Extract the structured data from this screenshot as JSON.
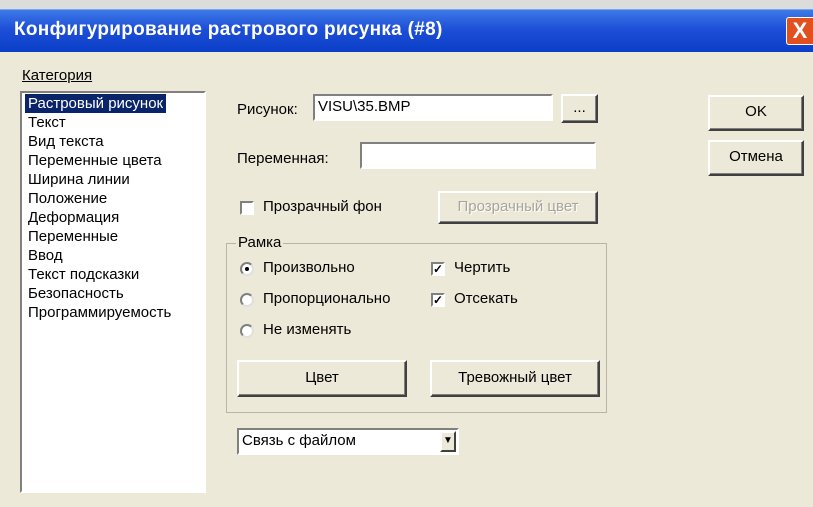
{
  "window": {
    "title": "Конфигурирование растрового рисунка (#8)",
    "close_glyph": "X"
  },
  "category": {
    "label": "Категория",
    "items": [
      {
        "label": "Растровый рисунок",
        "selected": true
      },
      {
        "label": "Текст"
      },
      {
        "label": "Вид текста"
      },
      {
        "label": "Переменные цвета"
      },
      {
        "label": "Ширина линии"
      },
      {
        "label": "Положение"
      },
      {
        "label": "Деформация"
      },
      {
        "label": "Переменные"
      },
      {
        "label": "Ввод"
      },
      {
        "label": "Текст подсказки"
      },
      {
        "label": "Безопасность"
      },
      {
        "label": "Программируемость"
      }
    ]
  },
  "picture": {
    "label": "Рисунок:",
    "value": "VISU\\35.BMP",
    "browse_label": "..."
  },
  "variable": {
    "label": "Переменная:",
    "value": ""
  },
  "transparent": {
    "label": "Прозрачный фон",
    "checked": false,
    "color_button": "Прозрачный цвет"
  },
  "frame": {
    "label": "Рамка",
    "radios": [
      {
        "label": "Произвольно",
        "selected": true
      },
      {
        "label": "Пропорционально",
        "selected": false
      },
      {
        "label": "Не изменять",
        "selected": false
      }
    ],
    "checks": [
      {
        "label": "Чертить",
        "checked": true
      },
      {
        "label": "Отсекать",
        "checked": true
      }
    ],
    "color_button": "Цвет",
    "alarm_color_button": "Тревожный цвет"
  },
  "file_link": {
    "value": "Связь с файлом",
    "arrow_glyph": "▼"
  },
  "buttons": {
    "ok": "OK",
    "cancel": "Отмена"
  },
  "colors": {
    "titlebar": "#1d4fd8",
    "selection": "#0a246a",
    "dialog_bg": "#ece9d8",
    "close": "#e2501f"
  }
}
